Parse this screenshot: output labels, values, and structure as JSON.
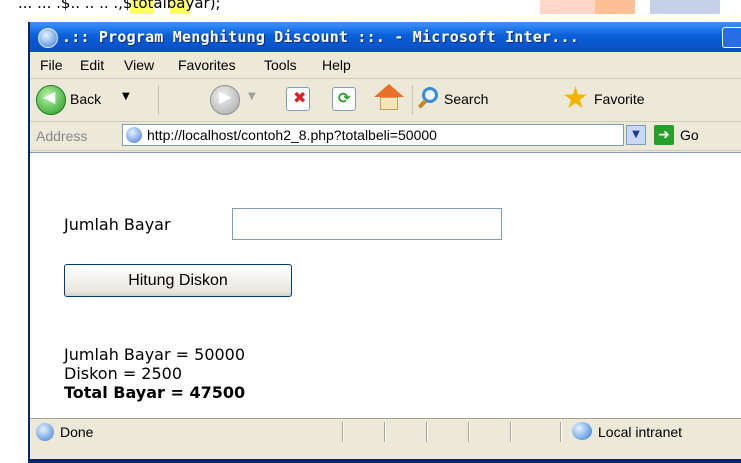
{
  "snippet": {
    "code": "...   ... .$..  ..  ..  .,$totalbayar);"
  },
  "window": {
    "title": ".:: Program Menghitung Discount ::. - Microsoft Inter..."
  },
  "menu": [
    "File",
    "Edit",
    "View",
    "Favorites",
    "Tools",
    "Help"
  ],
  "toolbar": {
    "back_label": "Back",
    "search_label": "Search",
    "favorites_label": "Favorite"
  },
  "address": {
    "label": "Address",
    "url": "http://localhost/contoh2_8.php?totalbeli=50000",
    "go_label": "Go"
  },
  "form": {
    "field_label": "Jumlah Bayar",
    "field_value": "",
    "button_label": "Hitung Diskon"
  },
  "results": {
    "line1": "Jumlah Bayar = 50000",
    "line2": "Diskon = 2500",
    "line3": "Total Bayar = 47500"
  },
  "status": {
    "text": "Done",
    "zone": "Local intranet"
  },
  "icons": {
    "app": "ie-page-icon",
    "back": "back-arrow-icon",
    "forward": "forward-arrow-icon",
    "stop": "stop-icon",
    "refresh": "refresh-icon",
    "home": "home-icon",
    "search": "search-icon",
    "favorites": "favorites-star-icon",
    "go": "go-arrow-icon",
    "zone": "local-intranet-icon"
  },
  "colors": {
    "titlebar": "#0a5fd8",
    "chrome": "#ece9d8",
    "content": "#ffffff"
  }
}
